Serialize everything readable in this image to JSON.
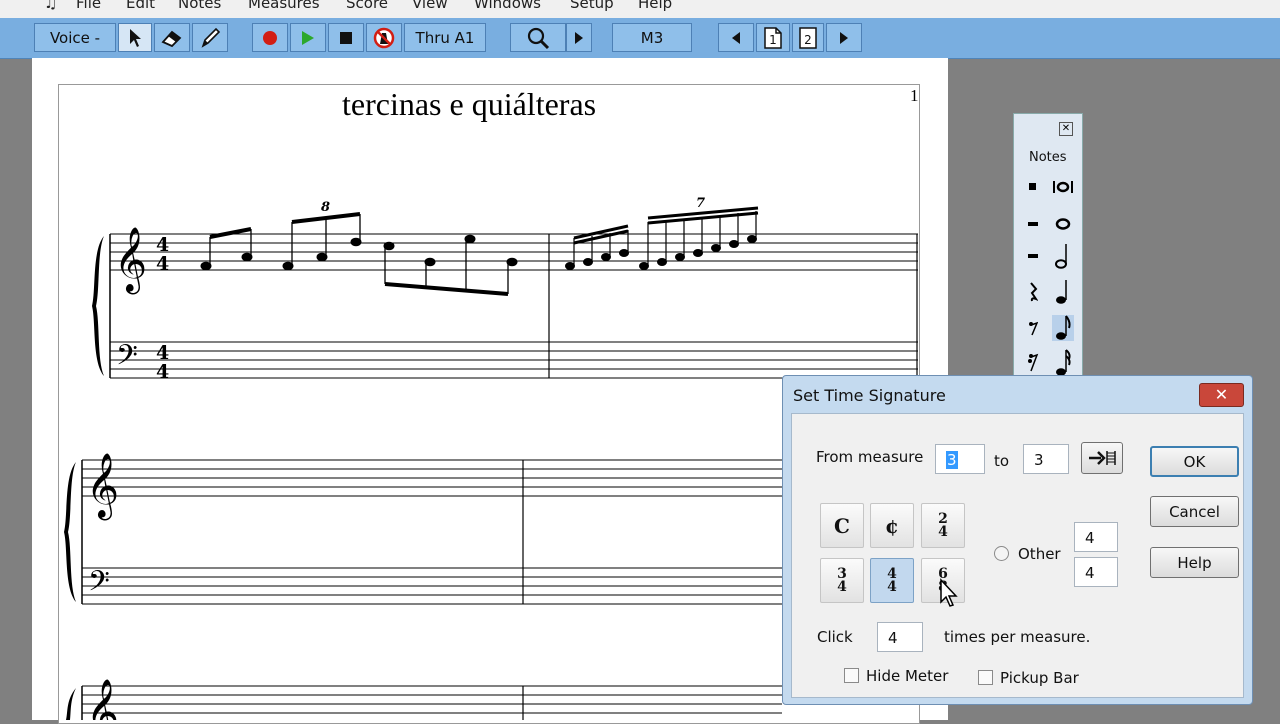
{
  "menu": [
    "File",
    "Edit",
    "Notes",
    "Measures",
    "Score",
    "View",
    "Windows",
    "Setup",
    "Help"
  ],
  "toolbar": {
    "voice_label": "Voice -",
    "playback_label": "Thru A1",
    "measure_label": "M3",
    "page_icons": [
      "1",
      "2"
    ]
  },
  "score": {
    "title": "tercinas e quiálteras",
    "page_number": "1",
    "time_signature_top": "4",
    "time_signature_bottom": "4",
    "tuplets": [
      "8",
      "7"
    ]
  },
  "palette": {
    "label": "Notes",
    "selected_duration": "eighth"
  },
  "dialog": {
    "title": "Set Time Signature",
    "from_label": "From measure",
    "from_value": "3",
    "to_label": "to",
    "to_value": "3",
    "ok": "OK",
    "cancel": "Cancel",
    "help": "Help",
    "presets": [
      {
        "name": "common-time",
        "text": "C"
      },
      {
        "name": "cut-time",
        "text": "¢"
      },
      {
        "name": "2-4",
        "top": "2",
        "bottom": "4"
      },
      {
        "name": "3-4",
        "top": "3",
        "bottom": "4"
      },
      {
        "name": "4-4",
        "top": "4",
        "bottom": "4",
        "selected": true
      },
      {
        "name": "6-8",
        "top": "6",
        "bottom": "8"
      }
    ],
    "other_label": "Other",
    "other_top": "4",
    "other_bottom": "4",
    "click_label": "Click",
    "click_value": "4",
    "click_suffix": "times per measure.",
    "hide_meter_label": "Hide Meter",
    "pickup_bar_label": "Pickup Bar"
  }
}
